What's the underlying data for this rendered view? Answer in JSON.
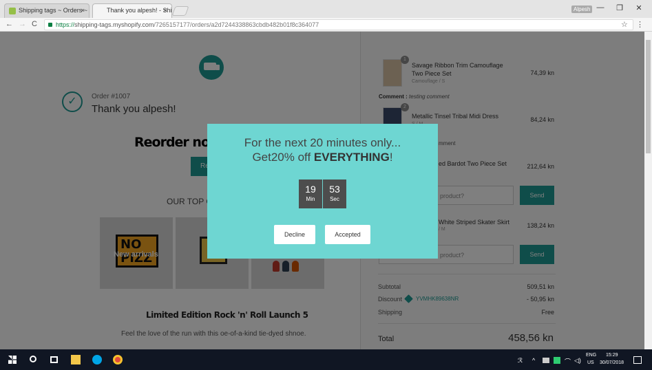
{
  "browser": {
    "tabs": [
      {
        "title": "Shipping tags ~ Orders ~",
        "close": "×"
      },
      {
        "title": "Thank you alpesh! - Ship",
        "close": "×"
      }
    ],
    "profile": "Alpesh",
    "window_controls": {
      "minimize": "—",
      "maximize": "❐",
      "close": "✕"
    },
    "nav": {
      "back": "←",
      "forward": "→",
      "reload": "C"
    },
    "url": {
      "secure": "https://",
      "host": "shipping-tags.myshopify.com",
      "path": "/7265157177/orders/a2d7244338863cbdb482b01f8c364077"
    },
    "star": "☆",
    "menu": "⋮"
  },
  "order": {
    "number": "Order #1007",
    "thanks": "Thank you alpesh!",
    "reorder_heading": "Reorder now a",
    "reorder_button": "Re",
    "top_collection_label": "OUR TOP C",
    "product_overlay": "New arrivals",
    "nope_text": "NO PIZZ",
    "collection_title": "Limited Edition Rock 'n' Roll Launch 5",
    "collection_desc": "Feel the love of the run with this oe-of-a-kind tie-dyed shnoe."
  },
  "items": [
    {
      "qty": "1",
      "name_l1": "Savage Ribbon Trim Camouflage",
      "name_l2": "Two Piece Set",
      "variant": "Camouflage / S",
      "price": "74,39 kn"
    },
    {
      "qty": "2",
      "name_l1": "Metallic Tinsel Tribal Midi Dress",
      "name_l2": "",
      "variant": "S / M",
      "price": "84,24 kn"
    },
    {
      "qty": "",
      "name_l1": "ed Bardot Two Piece Set",
      "name_l2": "",
      "variant": "",
      "price": "212,64 kn"
    },
    {
      "qty": "",
      "name_l1": "White Striped Skater Skirt",
      "name_l2": "",
      "variant": "/ M",
      "price": "138,24 kn"
    }
  ],
  "comments": [
    {
      "label": "Comment :",
      "text": "testing comment"
    },
    {
      "label": "",
      "text": "mment"
    }
  ],
  "question_inputs": [
    {
      "placeholder": "product?",
      "send": "Send"
    },
    {
      "placeholder": "product?",
      "send": "Send"
    }
  ],
  "summary": {
    "subtotal_label": "Subtotal",
    "subtotal": "509,51 kn",
    "discount_label": "Discount",
    "discount_code": "YVMHK89638NR",
    "discount": "- 50,95 kn",
    "shipping_label": "Shipping",
    "shipping": "Free",
    "total_label": "Total",
    "total": "458,56 kn"
  },
  "modal": {
    "line1": "For the next 20 minutes only...",
    "line2_prefix": "Get20% off ",
    "line2_bold": "EVERYTHING",
    "line2_suffix": "!",
    "timer": [
      {
        "value": "19",
        "unit": "Min"
      },
      {
        "value": "53",
        "unit": "Sec"
      }
    ],
    "decline": "Decline",
    "accept": "Accepted"
  },
  "taskbar": {
    "lang_top": "ENG",
    "lang_bottom": "US",
    "time": "15:29",
    "date": "30/07/2018"
  },
  "colors": {
    "accent": "#1f9b94",
    "modal_bg": "#6ed6d2",
    "timer_bg": "#4d4d4d"
  }
}
